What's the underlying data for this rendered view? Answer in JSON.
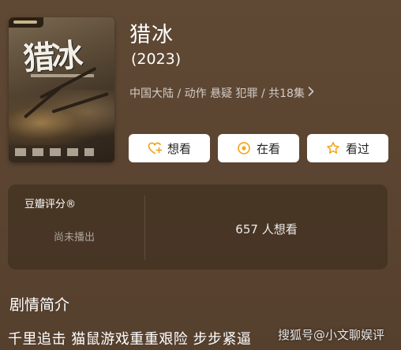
{
  "title": "猎冰",
  "year": "(2023)",
  "meta_text": "中国大陆 / 动作 悬疑 犯罪 / 共18集",
  "actions": {
    "want_label": "想看",
    "watching_label": "在看",
    "watched_label": "看过"
  },
  "rating": {
    "label": "豆瓣评分®",
    "empty_text": "尚未播出",
    "want_count_text": "657 人想看"
  },
  "synopsis": {
    "section_title": "剧情简介",
    "text": "千里追击 猫鼠游戏重重艰险 步步紧逼"
  },
  "watermark": {
    "text": "搜狐号@小文聊娱评"
  },
  "colors": {
    "background": "#5c4632",
    "accent_orange": "#f5a623",
    "button_bg": "#ffffff"
  },
  "icons": {
    "want": "heart-plus-icon",
    "watching": "target-circle-icon",
    "watched": "star-icon",
    "meta_more": "chevron-right-icon"
  }
}
